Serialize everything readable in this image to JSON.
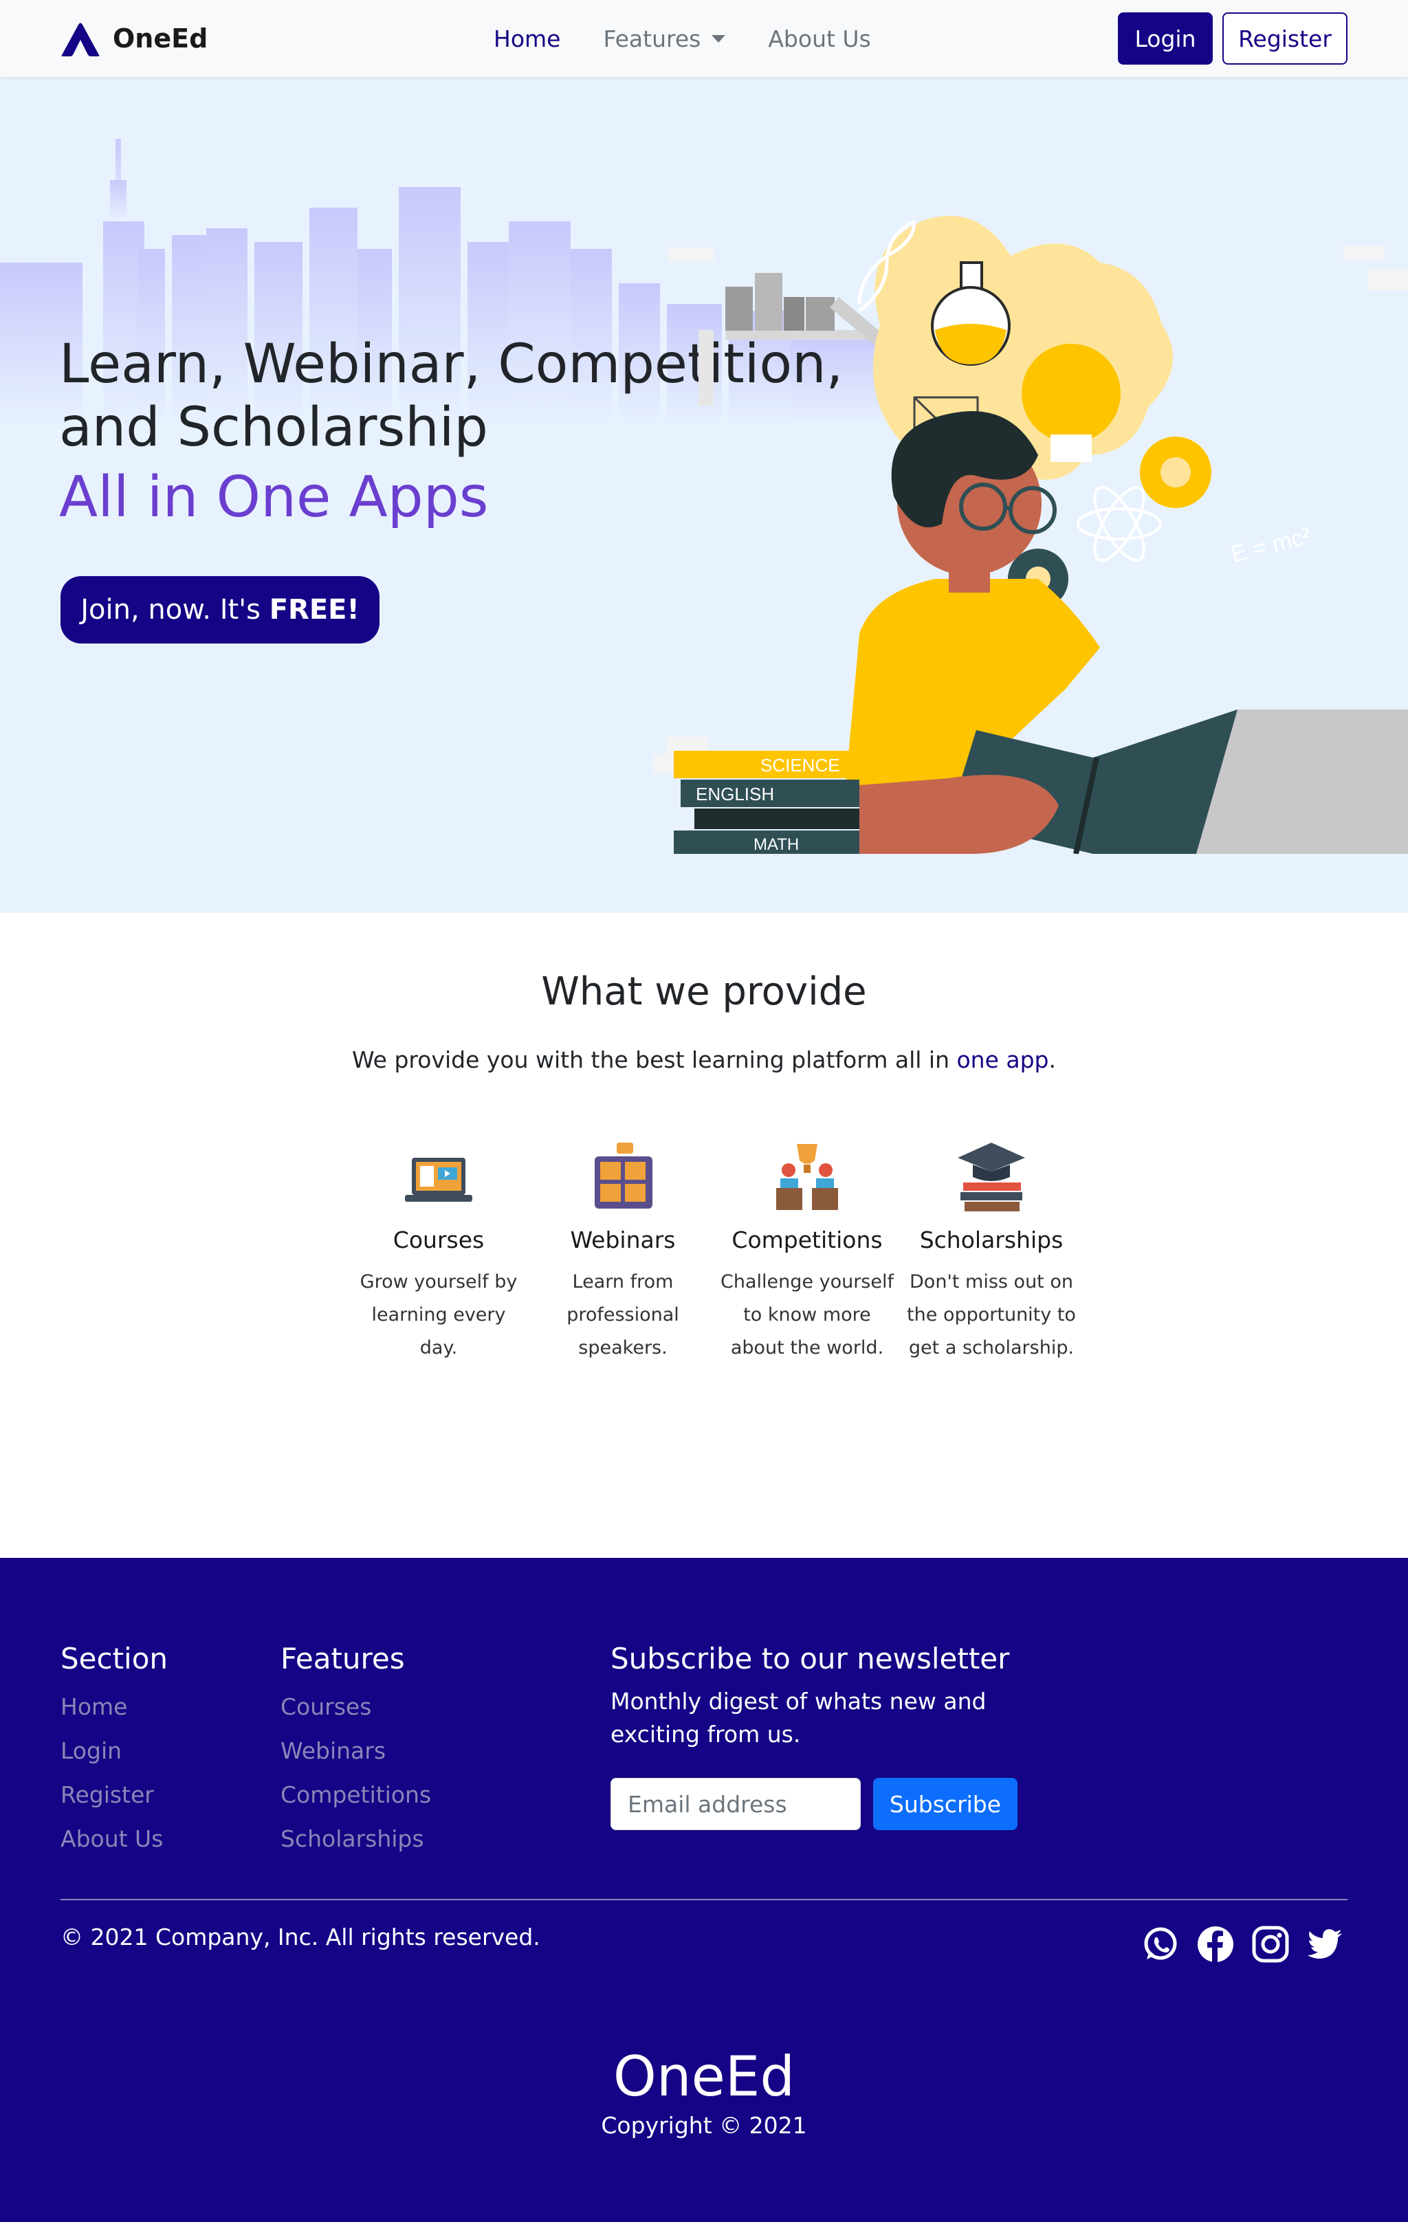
{
  "nav": {
    "brand": "OneEd",
    "links": [
      {
        "label": "Home",
        "active": true
      },
      {
        "label": "Features",
        "dropdown": true
      },
      {
        "label": "About Us"
      }
    ],
    "login": "Login",
    "register": "Register"
  },
  "hero": {
    "title": "Learn, Webinar, Competition, and Scholarship",
    "subtitle": "All in One Apps",
    "cta_prefix": "Join, now. It's ",
    "cta_bold": "FREE!",
    "book_labels": [
      "SCIENCE",
      "ENGLISH",
      "MATH"
    ],
    "formula": "E = mc²"
  },
  "provide": {
    "title": "What we provide",
    "subtitle_before": "We provide you with the best learning platform all in ",
    "subtitle_highlight": "one app",
    "subtitle_after": ".",
    "features": [
      {
        "icon": "laptop-course-icon",
        "title": "Courses",
        "text": "Grow yourself by learning every day."
      },
      {
        "icon": "webinar-icon",
        "title": "Webinars",
        "text": "Learn from professional speakers."
      },
      {
        "icon": "trophy-competition-icon",
        "title": "Competitions",
        "text": "Challenge yourself to know more about the world."
      },
      {
        "icon": "graduation-cap-icon",
        "title": "Scholarships",
        "text": "Don't miss out on the opportunity to get a scholarship."
      }
    ]
  },
  "footer": {
    "section_title": "Section",
    "section_links": [
      "Home",
      "Login",
      "Register",
      "About Us"
    ],
    "features_title": "Features",
    "features_links": [
      "Courses",
      "Webinars",
      "Competitions",
      "Scholarships"
    ],
    "newsletter_title": "Subscribe to our newsletter",
    "newsletter_text": "Monthly digest of whats new and exciting from us.",
    "email_placeholder": "Email address",
    "subscribe": "Subscribe",
    "copyright": "© 2021 Company, Inc. All rights reserved.",
    "social": [
      "whatsapp-icon",
      "facebook-icon",
      "instagram-icon",
      "twitter-icon"
    ],
    "brand": "OneEd",
    "brand_copy": "Copyright © 2021"
  },
  "colors": {
    "primary": "#150485",
    "accent_purple": "#6a3fcf",
    "hero_bg": "#e8f2fe",
    "subscribe_blue": "#0d6efd"
  }
}
